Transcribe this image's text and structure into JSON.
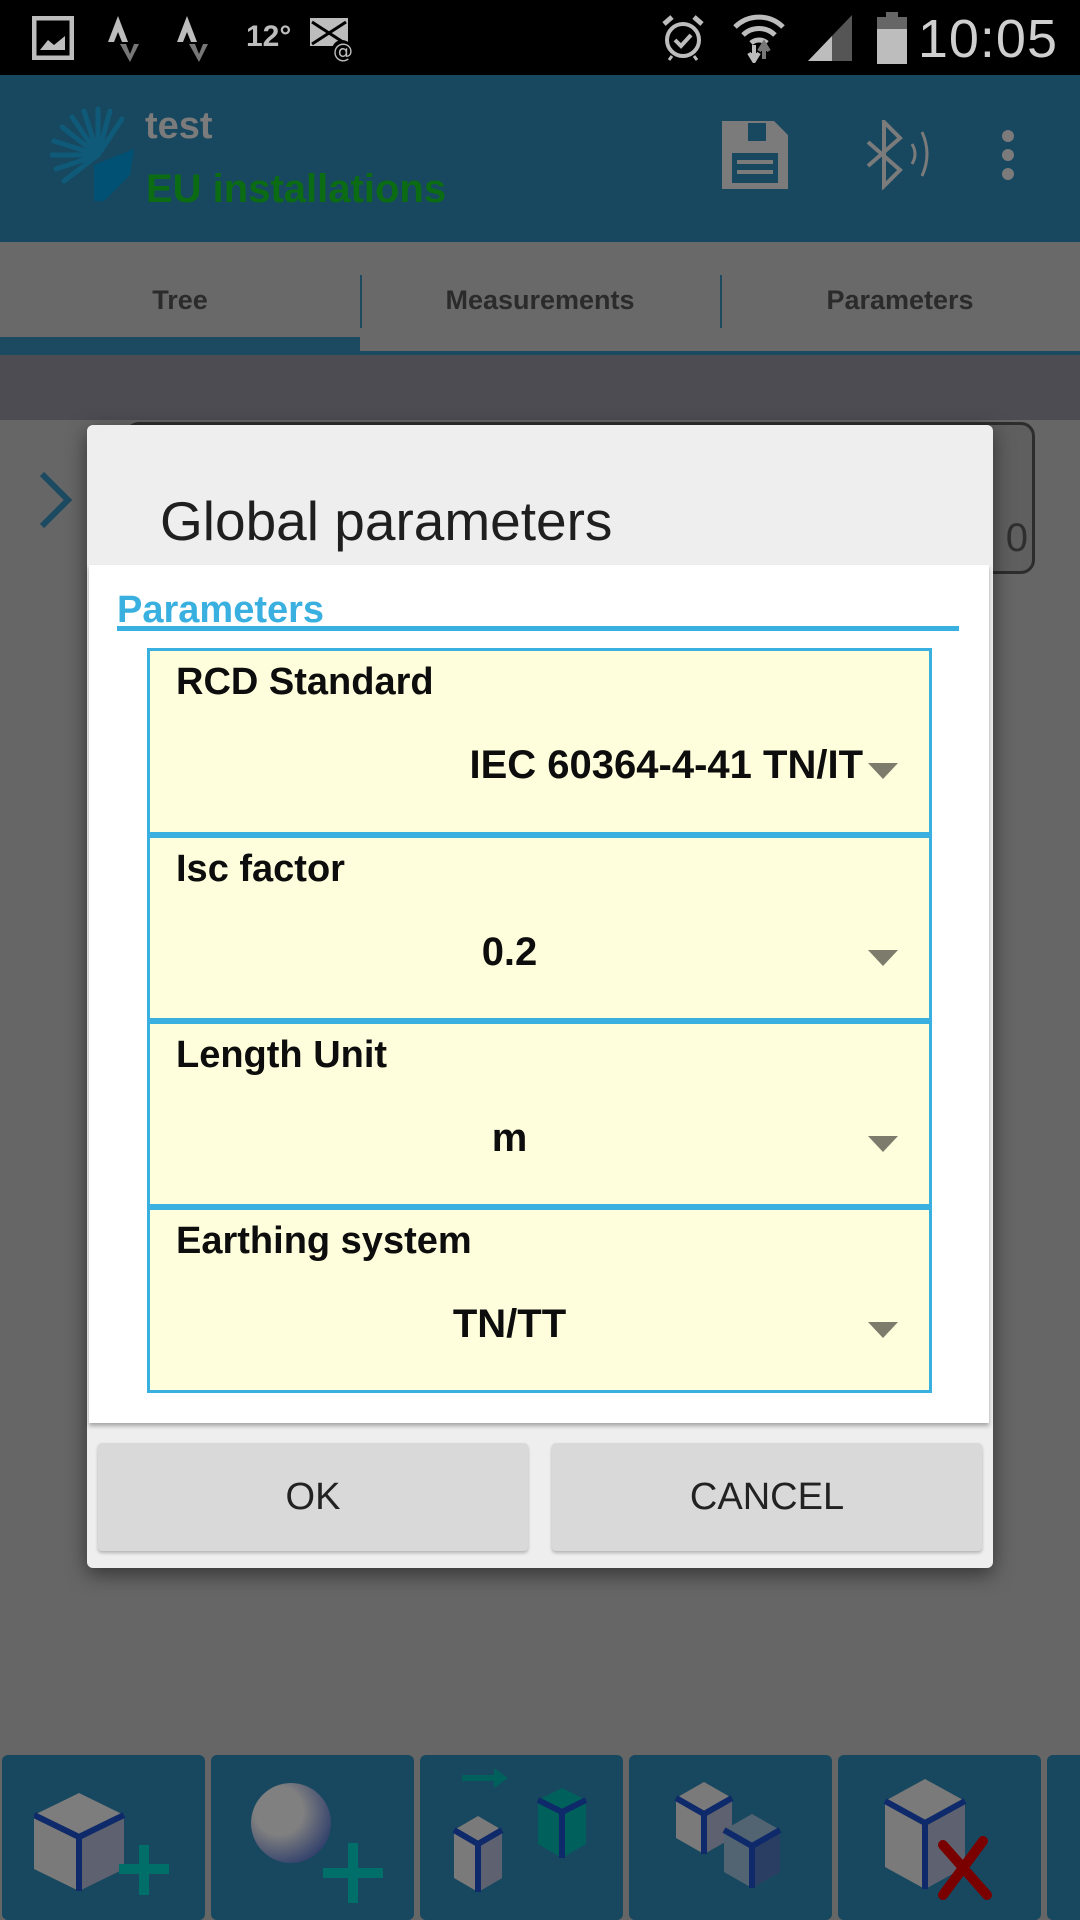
{
  "status_bar": {
    "left_icons": [
      "gallery-icon",
      "strava-icon",
      "strava-icon",
      "temperature-reading",
      "mail-error-icon"
    ],
    "temperature": "12°",
    "right_icons": [
      "alarm-icon",
      "wifi-icon",
      "signal-icon",
      "battery-icon"
    ],
    "time": "10:05"
  },
  "app_bar": {
    "title": "test",
    "subtitle": "EU installations",
    "actions": [
      "save-icon",
      "bluetooth-icon",
      "more-options-icon"
    ]
  },
  "tabs": [
    {
      "label": "Tree",
      "active": true
    },
    {
      "label": "Measurements",
      "active": false
    },
    {
      "label": "Parameters",
      "active": false
    }
  ],
  "background": {
    "box_value": "0"
  },
  "dialog": {
    "title": "Global parameters",
    "section_header": "Parameters",
    "parameters": [
      {
        "label": "RCD Standard",
        "value": "IEC 60364-4-41 TN/IT"
      },
      {
        "label": "Isc factor",
        "value": "0.2"
      },
      {
        "label": "Length Unit",
        "value": "m"
      },
      {
        "label": "Earthing system",
        "value": "TN/TT"
      }
    ],
    "ok_label": "OK",
    "cancel_label": "CANCEL"
  },
  "bottom_toolbar": [
    {
      "name": "add-object-button",
      "icon": "cube-plus-icon"
    },
    {
      "name": "add-sphere-button",
      "icon": "sphere-plus-icon"
    },
    {
      "name": "move-object-button",
      "icon": "cube-move-icon"
    },
    {
      "name": "copy-object-button",
      "icon": "cube-copy-icon"
    },
    {
      "name": "delete-object-button",
      "icon": "cube-delete-icon"
    }
  ],
  "colors": {
    "accent": "#39b0e0",
    "field_background": "#fefedc",
    "app_bar": "#17485f",
    "subtitle_green": "#0b6c14",
    "delete_red": "#8b0000"
  }
}
